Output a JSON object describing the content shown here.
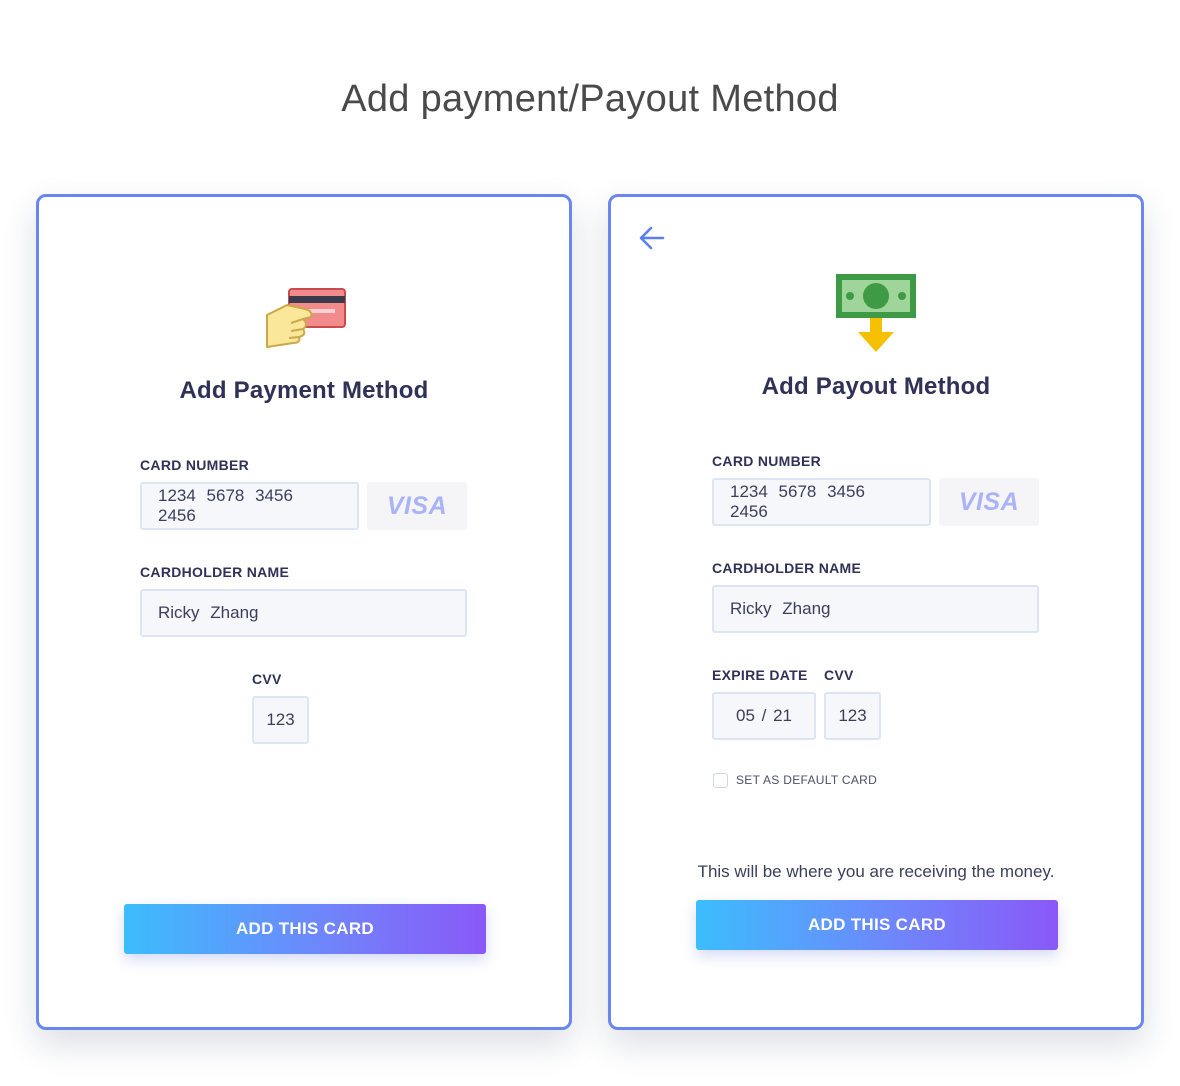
{
  "page": {
    "title": "Add payment/Payout Method"
  },
  "payment_card": {
    "title": "Add Payment Method",
    "card_number_label": "CARD NUMBER",
    "card_number_value": "1234  5678  3456  2456",
    "card_brand": "VISA",
    "cardholder_label": "CARDHOLDER NAME",
    "cardholder_value": "Ricky Zhang",
    "cvv_label": "CVV",
    "cvv_value": "123",
    "button_label": "ADD THIS CARD"
  },
  "payout_card": {
    "title": "Add Payout Method",
    "card_number_label": "CARD NUMBER",
    "card_number_value": "1234  5678  3456  2456",
    "card_brand": "VISA",
    "cardholder_label": "CARDHOLDER NAME",
    "cardholder_value": "Ricky Zhang",
    "expire_label": "EXPIRE DATE",
    "expire_value": "05  /  21",
    "cvv_label": "CVV",
    "cvv_value": "123",
    "default_checkbox_label": "SET AS DEFAULT CARD",
    "default_checked": false,
    "note": "This will be where you are receiving the money.",
    "button_label": "ADD THIS CARD"
  },
  "icons": {
    "back": "arrow-left-icon",
    "payment": "hand-holding-card-icon",
    "payout": "money-bill-download-icon"
  },
  "colors": {
    "card_border": "#6b86f0",
    "button_gradient_start": "#3cbdfd",
    "button_gradient_end": "#8a58f8",
    "heading": "#2f3157",
    "visa": "#a9b3f5"
  }
}
